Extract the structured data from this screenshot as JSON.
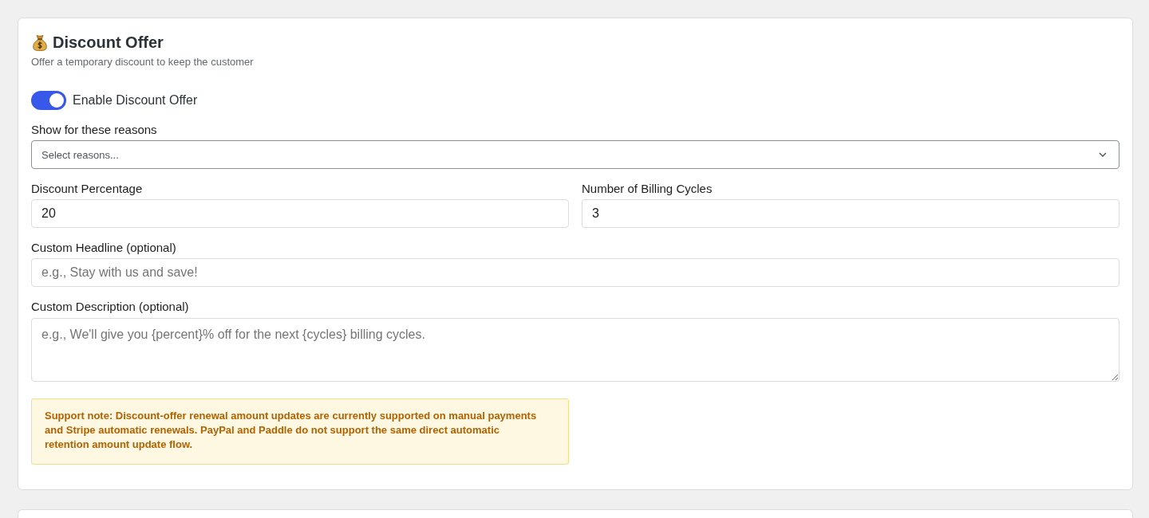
{
  "card": {
    "title": "Discount Offer",
    "subtitle": "Offer a temporary discount to keep the customer",
    "toggle": {
      "label": "Enable Discount Offer",
      "on": true
    },
    "fields": [
      {
        "kind": "select",
        "label": "Show for these reasons",
        "placeholder": "Select reasons..."
      },
      {
        "kind": "pair",
        "items": [
          {
            "kind": "text",
            "label": "Discount Percentage",
            "value": "20"
          },
          {
            "kind": "text",
            "label": "Number of Billing Cycles",
            "value": "3"
          }
        ]
      },
      {
        "kind": "text",
        "label": "Custom Headline (optional)",
        "placeholder": "e.g., Stay with us and save!"
      },
      {
        "kind": "textarea",
        "label": "Custom Description (optional)",
        "placeholder": "e.g., We'll give you {percent}% off for the next {cycles} billing cycles."
      }
    ],
    "notice": "Support note: Discount-offer renewal amount updates are currently supported on manual payments and Stripe automatic renewals. PayPal and Paddle do not support the same direct automatic retention amount update flow."
  }
}
